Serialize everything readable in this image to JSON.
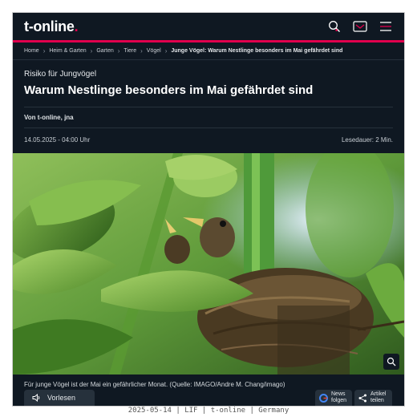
{
  "header": {
    "logo_text": "t-online",
    "logo_dot": ".",
    "accent_color": "#e0004d",
    "icons": [
      "search-icon",
      "mail-icon",
      "menu-icon"
    ]
  },
  "breadcrumb": {
    "items": [
      "Home",
      "Heim & Garten",
      "Garten",
      "Tiere",
      "Vögel"
    ],
    "current": "Junge Vögel: Warum Nestlinge besonders im Mai gefährdet sind"
  },
  "article": {
    "kicker": "Risiko für Jungvögel",
    "headline": "Warum Nestlinge besonders im Mai gefährdet sind",
    "author": "Von t-online, jna",
    "date": "14.05.2025 - 04:00 Uhr",
    "reading_time": "Lesedauer: 2 Min.",
    "caption": "Für junge Vögel ist der Mai ein gefährlicher Monat. (Quelle: IMAGO/Andre M. Chang/imago)"
  },
  "actions": {
    "read_aloud": "Vorlesen",
    "news_line1": "News",
    "news_line2": "folgen",
    "share_line1": "Artikel",
    "share_line2": "teilen"
  },
  "footer": {
    "text": "2025-05-14 | LIF | t-online | Germany"
  }
}
